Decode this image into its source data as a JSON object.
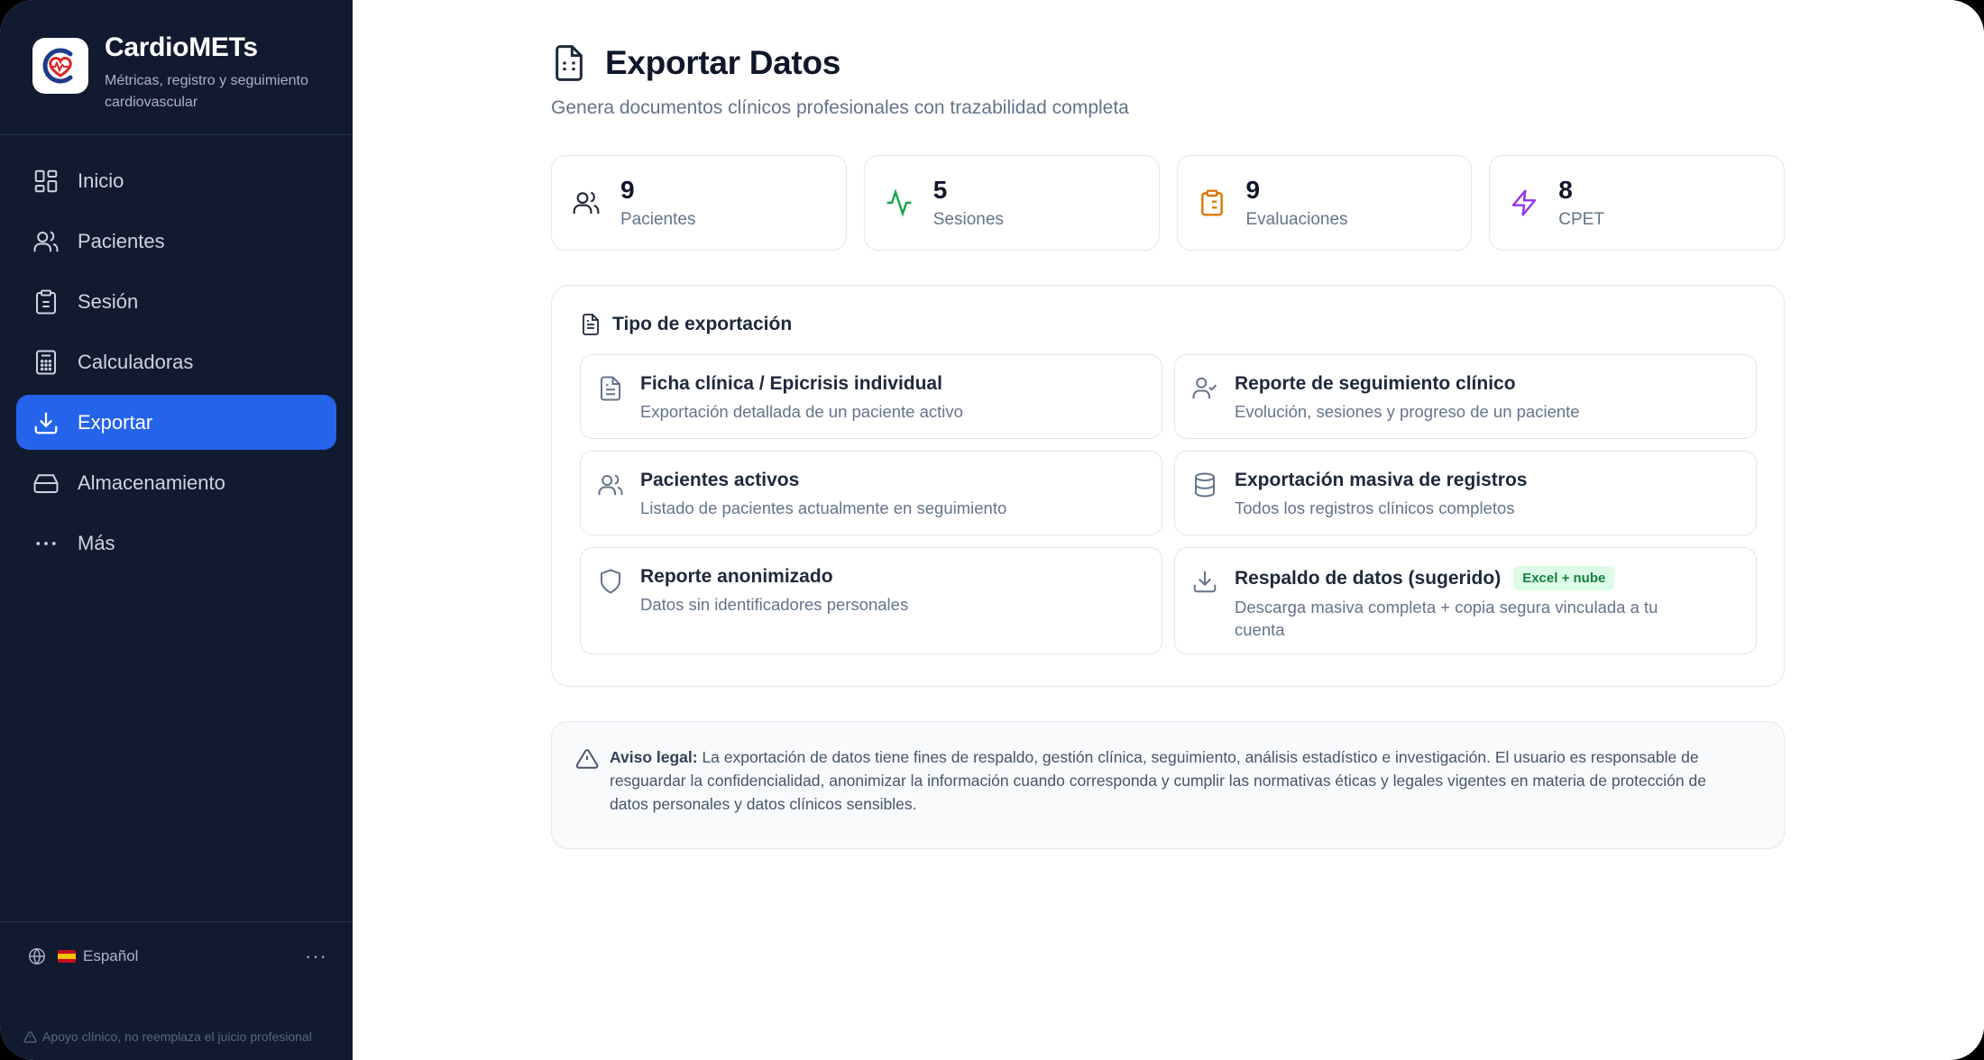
{
  "app": {
    "name": "CardioMETs",
    "tagline": "Métricas, registro y seguimiento cardiovascular"
  },
  "sidebar": {
    "items": [
      {
        "label": "Inicio",
        "icon": "grid-icon"
      },
      {
        "label": "Pacientes",
        "icon": "users-icon"
      },
      {
        "label": "Sesión",
        "icon": "clipboard-icon"
      },
      {
        "label": "Calculadoras",
        "icon": "calculator-icon"
      },
      {
        "label": "Exportar",
        "icon": "download-icon",
        "active": true
      },
      {
        "label": "Almacenamiento",
        "icon": "hard-drive-icon"
      },
      {
        "label": "Más",
        "icon": "more-horizontal-icon"
      }
    ],
    "language": "Español",
    "disclaimer": "Apoyo clínico, no reemplaza el juicio profesional"
  },
  "header": {
    "title": "Exportar Datos",
    "subtitle": "Genera documentos clínicos profesionales con trazabilidad completa"
  },
  "stats": [
    {
      "value": "9",
      "label": "Pacientes",
      "icon": "users-icon",
      "color": "#1e293b"
    },
    {
      "value": "5",
      "label": "Sesiones",
      "icon": "activity-icon",
      "color": "#16a34a"
    },
    {
      "value": "9",
      "label": "Evaluaciones",
      "icon": "clipboard-list-icon",
      "color": "#d97706"
    },
    {
      "value": "8",
      "label": "CPET",
      "icon": "zap-icon",
      "color": "#9333ea"
    }
  ],
  "export": {
    "section_title": "Tipo de exportación",
    "options": [
      {
        "title": "Ficha clínica / Epicrisis individual",
        "desc": "Exportación detallada de un paciente activo",
        "icon": "file-text-icon"
      },
      {
        "title": "Reporte de seguimiento clínico",
        "desc": "Evolución, sesiones y progreso de un paciente",
        "icon": "user-check-icon"
      },
      {
        "title": "Pacientes activos",
        "desc": "Listado de pacientes actualmente en seguimiento",
        "icon": "users-icon"
      },
      {
        "title": "Exportación masiva de registros",
        "desc": "Todos los registros clínicos completos",
        "icon": "database-icon"
      },
      {
        "title": "Reporte anonimizado",
        "desc": "Datos sin identificadores personales",
        "icon": "shield-icon"
      },
      {
        "title": "Respaldo de datos (sugerido)",
        "desc": "Descarga masiva completa + copia segura vinculada a tu cuenta",
        "icon": "download-icon",
        "badge": "Excel + nube"
      }
    ]
  },
  "legal": {
    "label": "Aviso legal:",
    "text": "La exportación de datos tiene fines de respaldo, gestión clínica, seguimiento, análisis estadístico e investigación. El usuario es responsable de resguardar la confidencialidad, anonimizar la información cuando corresponda y cumplir las normativas éticas y legales vigentes en materia de protección de datos personales y datos clínicos sensibles."
  },
  "colors": {
    "sidebar_bg": "#111a2e",
    "accent": "#2563eb",
    "badge_bg": "#dcfce7",
    "badge_text": "#15803d"
  }
}
